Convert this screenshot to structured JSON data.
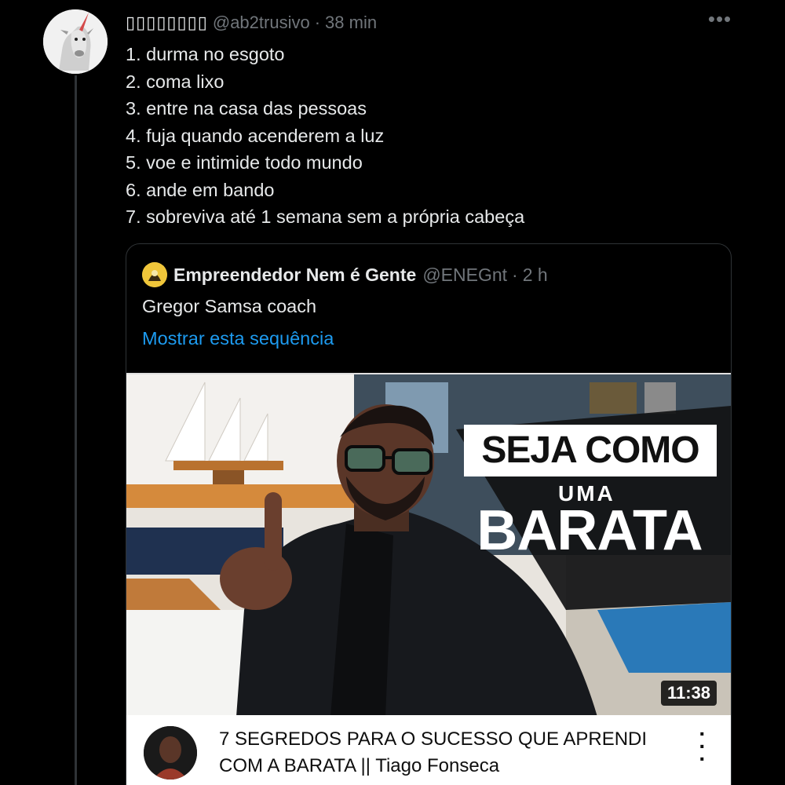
{
  "tweet": {
    "display_name": "▯▯▯▯▯▯▯▯",
    "handle": "@ab2trusivo",
    "separator": "·",
    "time": "38 min",
    "more_icon": "more-horizontal-icon",
    "lines": [
      "1. durma no esgoto",
      "2. coma lixo",
      "3. entre na casa das pessoas",
      "4. fuja quando acenderem a luz",
      "5. voe e intimide todo mundo",
      "6. ande em bando",
      "7. sobreviva até 1 semana sem a própria cabeça"
    ]
  },
  "quote": {
    "name": "Empreendedor Nem é Gente",
    "handle": "@ENEGnt",
    "separator": "·",
    "time": "2 h",
    "text": "Gregor Samsa coach",
    "thread_link": "Mostrar esta sequência",
    "video": {
      "overlay_line1": "SEJA COMO",
      "overlay_line2": "UMA",
      "overlay_line3": "BARATA",
      "duration": "11:38",
      "title_line1": "7 SEGREDOS PARA O SUCESSO QUE APRENDI",
      "title_line2": "COM A BARATA || Tiago Fonseca",
      "more_icon": "more-vertical-icon"
    }
  },
  "colors": {
    "background": "#000000",
    "text": "#e7e9ea",
    "secondary": "#71767b",
    "link": "#1d9bf0",
    "border": "#2f3336"
  }
}
